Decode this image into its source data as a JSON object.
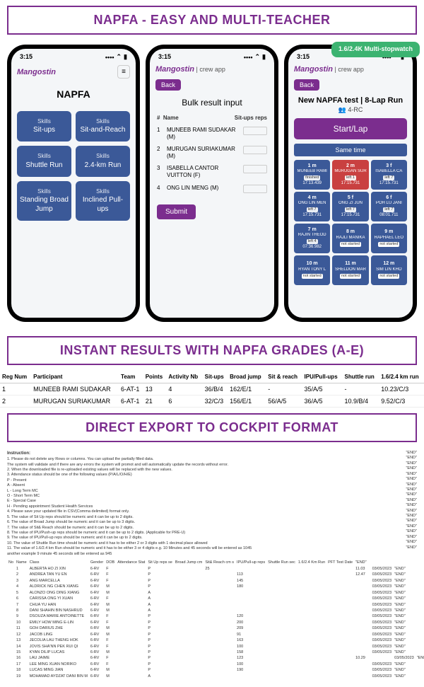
{
  "banners": {
    "top": "NAPFA - EASY AND MULTI-TEACHER",
    "mid": "INSTANT RESULTS WITH NAPFA GRADES (A-E)",
    "bot": "DIRECT EXPORT TO COCKPIT FORMAT"
  },
  "statusbar": {
    "time": "3:15",
    "signal": "●●●",
    "wifi": "▲",
    "batt": "■"
  },
  "brand": "Mangostin",
  "phone1": {
    "hamburger": "≡",
    "title": "NAPFA",
    "skills_label": "Skills",
    "tiles": [
      "Sit-ups",
      "Sit-and-Reach",
      "Shuttle Run",
      "2.4-km Run",
      "Standing Broad Jump",
      "Inclined Pull-ups"
    ]
  },
  "phone2": {
    "header_sub": "| crew app",
    "back": "Back",
    "title": "Bulk result input",
    "col_num": "#",
    "col_name": "Name",
    "col_reps": "Sit-ups reps",
    "rows": [
      {
        "n": "1",
        "name": "MUNEEB RAMI SUDAKAR (M)"
      },
      {
        "n": "2",
        "name": "MURUGAN SURIAKUMAR (M)"
      },
      {
        "n": "3",
        "name": "ISABELLA CANTOR VUITTON (F)"
      },
      {
        "n": "4",
        "name": "ONG LIN MENG (M)"
      }
    ],
    "submit": "Submit"
  },
  "phone3": {
    "badge": "1.6/2.4K Multi-stopwatch",
    "header_sub": "| crew app",
    "back": "Back",
    "title": "New NAPFA test | 8-Lap Run",
    "group_icon": "👥",
    "group": "4-RC",
    "start": "Start/Lap",
    "sametime": "Same time",
    "runners": [
      {
        "pos": "1 m",
        "name": "MUNEEB RAMI",
        "tag": "finished",
        "time": "17:13.439",
        "cls": "r-blue"
      },
      {
        "pos": "2 m",
        "name": "MURUGAN SUR",
        "tag": "left 1",
        "time": "17:15.731",
        "cls": "r-red"
      },
      {
        "pos": "3 f",
        "name": "ISABELLA CA",
        "tag": "left 7",
        "time": "17:15.731",
        "cls": "r-blue"
      },
      {
        "pos": "4 m",
        "name": "ONG LIN MEN",
        "tag": "left 7",
        "time": "17:15.731",
        "cls": "r-blue"
      },
      {
        "pos": "5 f",
        "name": "ONG ZI JUN",
        "tag": "left 7",
        "time": "17:15.731",
        "cls": "r-blue"
      },
      {
        "pos": "6 f",
        "name": "POH LU JANI",
        "tag": "left 7",
        "time": "08:01.711",
        "cls": "r-blue"
      },
      {
        "pos": "7 m",
        "name": "RAJIN THEOD",
        "tag": "left 4",
        "time": "07:36.982",
        "cls": "r-blue"
      },
      {
        "pos": "8 m",
        "name": "RAJLI MANIKA",
        "tag": "not started",
        "time": "",
        "cls": "r-blue"
      },
      {
        "pos": "9 m",
        "name": "RAPHAEL LEO",
        "tag": "not started",
        "time": "",
        "cls": "r-blue"
      },
      {
        "pos": "10 m",
        "name": "RYAN TONY L",
        "tag": "not started",
        "time": "",
        "cls": "r-blue"
      },
      {
        "pos": "11 m",
        "name": "SHELDON MAR",
        "tag": "not started",
        "time": "",
        "cls": "r-blue"
      },
      {
        "pos": "12 m",
        "name": "SIM LIN KHO",
        "tag": "not started",
        "time": "",
        "cls": "r-blue"
      }
    ]
  },
  "results": {
    "headers": [
      "Reg Num",
      "Participant",
      "Team",
      "Points",
      "Activity Nb",
      "Sit-ups",
      "Broad jump",
      "Sit & reach",
      "IPU/Pull-ups",
      "Shuttle run",
      "1.6/2.4 km run"
    ],
    "rows": [
      [
        "1",
        "MUNEEB RAMI SUDAKAR",
        "6-AT-1",
        "13",
        "4",
        "36/B/4",
        "162/E/1",
        "-",
        "35/A/5",
        "-",
        "10.23/C/3"
      ],
      [
        "2",
        "MURUGAN SURIAKUMAR",
        "6-AT-1",
        "21",
        "6",
        "32/C/3",
        "156/E/1",
        "56/A/5",
        "36/A/5",
        "10.9/B/4",
        "9.52/C/3"
      ]
    ]
  },
  "cockpit": {
    "instr_title": "Instruction:",
    "instructions": [
      "1. Please do not delete any Rows or columns. You can upload the partially filled data.",
      "   The system will validate and if there are any errors the system will promot and will automatically update the records without error.",
      "2. When the downloaded file is re-uploaded existing values will be replaced with the new values.",
      "3. Attendance status should be one of the following values (P/A/L/O/H/E)",
      "   P - Present",
      "   A - Absent",
      "   L - Long Term MC",
      "   O - Short Term MC",
      "   E - Special Case",
      "   H - Pending appointment Student Health Services",
      "4. Please save your updated file in CSV(Comma delimited) format only.",
      "5. The value of Sit Up reps should be numeric and it can be up to 2 digits.",
      "6. The value of Broad Jump should be numeric and it can be up to 3 digits.",
      "7. The value of Sit& Reach should be numeric and it can be up to 2 digits.",
      "8. The value of IPU/Push-up reps should be numeric and it can be up to 2 digits. (Applicable for PRE-U)",
      "9. The value of IPU/Pull-up reps should be numeric and it can be up to 2 digits.",
      "10. The value of Shuttle Run time should be numeric and it has to be either 2 or 3 digits with 1 decimal place allowed",
      "11. The value of 1.6/2.4 km Run should be numeric and it has to be either 3 or 4 digits e.g. 10 Minutes and 45 seconds will be entered as 1045",
      "    another example 9 minute 45 seconds will be entered as 945"
    ],
    "end_tag": "\"END\"",
    "headers": [
      "No",
      "Name",
      "Class",
      "Gender",
      "DOB",
      "Attendance Stat",
      "Sit Up reps se",
      "Broad Jump cm ",
      "Sit& Reach cm s",
      "IPU/Pull-up reps",
      "Shuttle Run sec",
      "1.6/2.4 Km Run",
      "PFT Test Date",
      "\"END\""
    ],
    "rows": [
      [
        "",
        "1",
        "ALBERTA HO ZI XIN",
        "6-RV",
        "F",
        "",
        "P",
        "",
        "25",
        "",
        "",
        "",
        "",
        "11.03",
        "",
        "03/05/2023",
        "\"END\""
      ],
      [
        "",
        "2",
        "ANDREA TAN YU EN",
        "6-RV",
        "F",
        "",
        "P",
        "",
        "",
        "113",
        "",
        "",
        "",
        "12.47",
        "",
        "03/05/2023",
        "\"END\""
      ],
      [
        "",
        "3",
        "ANG MARCELLA",
        "6-RV",
        "F",
        "",
        "P",
        "",
        "",
        "145",
        "",
        "",
        "",
        "",
        "",
        "03/05/2023",
        "\"END\""
      ],
      [
        "",
        "4",
        "ALDRICK NG CHEN XIANG",
        "6-RV",
        "M",
        "",
        "P",
        "",
        "",
        "180",
        "",
        "",
        "",
        "",
        "",
        "03/05/2023",
        "\"END\""
      ],
      [
        "",
        "5",
        "ALONZO ONG DING XIANG",
        "6-RV",
        "M",
        "",
        "A",
        "",
        "",
        "",
        "",
        "",
        "",
        "",
        "",
        "03/05/2023",
        "\"END\""
      ],
      [
        "",
        "6",
        "CARISSA  ONG YI XUAN",
        "6-RV",
        "F",
        "",
        "A",
        "",
        "",
        "",
        "",
        "",
        "",
        "",
        "",
        "03/05/2023",
        "\"END\""
      ],
      [
        "",
        "7",
        "CHUA YU HAN",
        "6-RV",
        "M",
        "",
        "A",
        "",
        "",
        "",
        "",
        "",
        "",
        "",
        "",
        "03/05/2023",
        "\"END\""
      ],
      [
        "",
        "8",
        "DANI SHAHIN BIN NASHRUD",
        "6-RV",
        "M",
        "",
        "A",
        "",
        "",
        "",
        "",
        "",
        "",
        "",
        "",
        "03/05/2023",
        "\"END\""
      ],
      [
        "",
        "9",
        "DSOUZA MARIE ANTOINETTE",
        "6-RV",
        "F",
        "",
        "P",
        "",
        "",
        "120",
        "",
        "",
        "",
        "",
        "",
        "03/05/2023",
        "\"END\""
      ],
      [
        "",
        "10",
        "EMILY HOW MING E-LIN",
        "6-RV",
        "F",
        "",
        "P",
        "",
        "",
        "200",
        "",
        "",
        "",
        "",
        "",
        "03/05/2023",
        "\"END\""
      ],
      [
        "",
        "11",
        "GOH DARIUS ZHE",
        "6-RV",
        "M",
        "",
        "P",
        "",
        "",
        "209",
        "",
        "",
        "",
        "",
        "",
        "03/05/2023",
        "\"END\""
      ],
      [
        "",
        "12",
        "JACOB LING",
        "6-RV",
        "M",
        "",
        "P",
        "",
        "",
        "91",
        "",
        "",
        "",
        "",
        "",
        "03/05/2023",
        "\"END\""
      ],
      [
        "",
        "13",
        "JECOLIA LAU THENG HOK",
        "6-RV",
        "F",
        "",
        "P",
        "",
        "",
        "163",
        "",
        "",
        "",
        "",
        "",
        "03/05/2023",
        "\"END\""
      ],
      [
        "",
        "14",
        "JOVIS SHA'NN PEK RUI QI",
        "6-RV",
        "F",
        "",
        "P",
        "",
        "",
        "100",
        "",
        "",
        "",
        "",
        "",
        "03/05/2023",
        "\"END\""
      ],
      [
        "",
        "15",
        "KYAN DILIP LUCAS",
        "6-RV",
        "M",
        "",
        "P",
        "",
        "",
        "158",
        "",
        "",
        "",
        "",
        "",
        "03/05/2023",
        "\"END\""
      ],
      [
        "",
        "16",
        "LAU JAIME",
        "6-RV",
        "F",
        "",
        "P",
        "",
        "",
        "123",
        "",
        "",
        "",
        "10.29",
        "",
        "",
        "03/05/2023",
        "\"END\""
      ],
      [
        "",
        "17",
        "LEE MING XUAN NORIKO",
        "6-RV",
        "F",
        "",
        "P",
        "",
        "",
        "100",
        "",
        "",
        "",
        "",
        "",
        "03/05/2023",
        "\"END\""
      ],
      [
        "",
        "18",
        "LUCAS MING JIAN",
        "6-RV",
        "M",
        "",
        "P",
        "",
        "",
        "190",
        "",
        "",
        "",
        "",
        "",
        "03/05/2023",
        "\"END\""
      ],
      [
        "",
        "19",
        "MOHAMAD AYDZAT DANI BIN M",
        "6-RV",
        "M",
        "",
        "A",
        "",
        "",
        "",
        "",
        "",
        "",
        "",
        "",
        "03/05/2023",
        "\"END\""
      ]
    ]
  }
}
